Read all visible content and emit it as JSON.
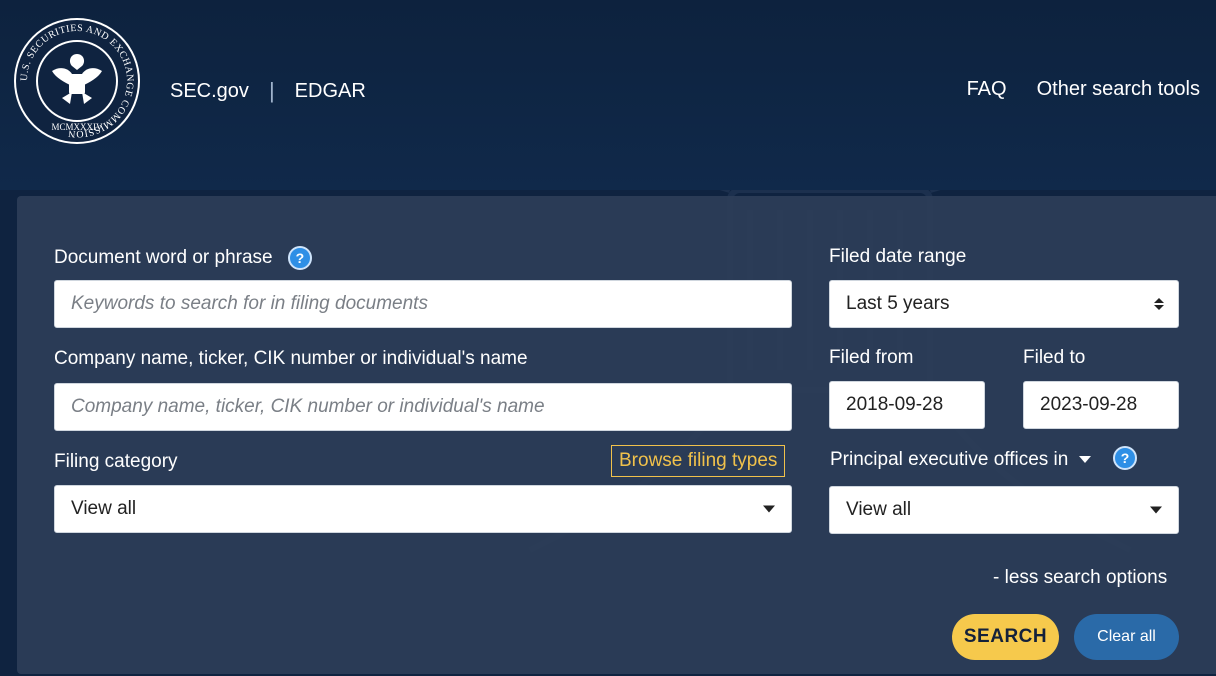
{
  "header": {
    "seal_text": "U.S. SECURITIES AND EXCHANGE COMMISSION",
    "seal_year": "MCMXXXIV",
    "nav_left": [
      "SEC.gov",
      "EDGAR"
    ],
    "nav_separator": "|",
    "nav_right": [
      "FAQ",
      "Other search tools"
    ]
  },
  "form": {
    "document_label": "Document word or phrase",
    "document_placeholder": "Keywords to search for in filing documents",
    "company_label": "Company name, ticker, CIK number or individual's name",
    "company_placeholder": "Company name, ticker, CIK number or individual's name",
    "filing_category_label": "Filing category",
    "filing_category_value": "View all",
    "browse_label": "Browse filing types",
    "date_range_label": "Filed date range",
    "date_range_value": "Last 5 years",
    "filed_from_label": "Filed from",
    "filed_from_value": "2018-09-28",
    "filed_to_label": "Filed to",
    "filed_to_value": "2023-09-28",
    "peo_label": "Principal executive offices in",
    "peo_value": "View all",
    "help_glyph": "?",
    "less_options": "- less search options",
    "search_button": "SEARCH",
    "clear_button": "Clear all"
  },
  "colors": {
    "background": "#0f2340",
    "panel": "#2c3e58",
    "accent_yellow": "#f6c94c",
    "browse_border": "#f0c14b",
    "clear_blue": "#2a6aa8",
    "help_blue": "#2e8fe6"
  }
}
